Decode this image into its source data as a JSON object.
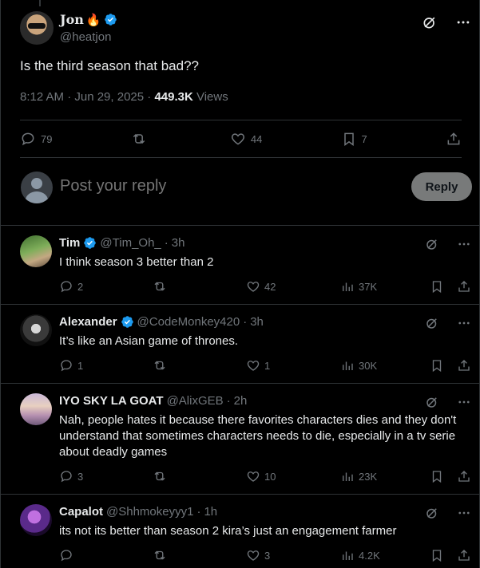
{
  "colors": {
    "verified": "#1d9bf0",
    "muted": "#71767b",
    "text": "#e7e9ea",
    "reply_button_bg": "#787a7a"
  },
  "main_tweet": {
    "name": "Jon",
    "name_emoji": "🔥",
    "handle": "@heatjon",
    "text": "Is the third season that bad??",
    "time": "8:12 AM · Jun 29, 2025 · ",
    "views_count": "449.3K",
    "views_label": " Views",
    "stats": {
      "replies": "79",
      "reposts": "",
      "likes": "44",
      "bookmarks": "7"
    }
  },
  "composer": {
    "placeholder": "Post your reply",
    "button_label": "Reply"
  },
  "replies": [
    {
      "name": "Tim",
      "handle": "@Tim_Oh_",
      "time": "3h",
      "text": "I think season 3 better than 2",
      "replies": "2",
      "likes": "42",
      "views": "37K"
    },
    {
      "name": "Alexander",
      "handle": "@CodeMonkey420",
      "time": "3h",
      "text": "It’s like an Asian game of thrones.",
      "replies": "1",
      "likes": "1",
      "views": "30K"
    },
    {
      "name": "IYO SKY LA GOAT",
      "handle": "@AlixGEB",
      "time": "2h",
      "text": "Nah, people hates it because there favorites characters dies and they don't understand that sometimes characters needs to die, especially in a tv serie about deadly games",
      "replies": "3",
      "likes": "10",
      "views": "23K"
    },
    {
      "name": "Capalot",
      "handle": "@Shhmokeyyy1",
      "time": "1h",
      "text": "its not its better than season 2 kira’s just an engagement farmer",
      "replies": "",
      "likes": "3",
      "views": "4.2K"
    }
  ]
}
